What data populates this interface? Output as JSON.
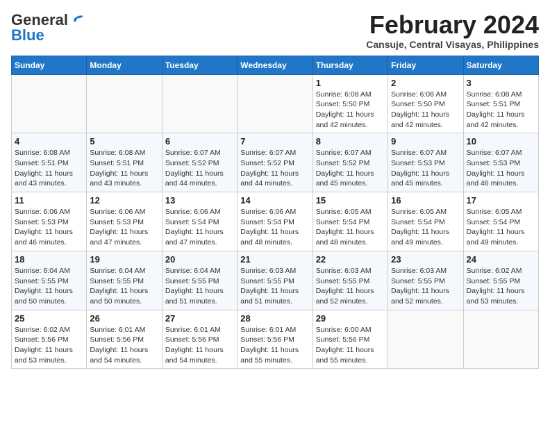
{
  "header": {
    "logo_line1": "General",
    "logo_line2": "Blue",
    "month_title": "February 2024",
    "location": "Cansuje, Central Visayas, Philippines"
  },
  "weekdays": [
    "Sunday",
    "Monday",
    "Tuesday",
    "Wednesday",
    "Thursday",
    "Friday",
    "Saturday"
  ],
  "weeks": [
    [
      {
        "date": "",
        "info": ""
      },
      {
        "date": "",
        "info": ""
      },
      {
        "date": "",
        "info": ""
      },
      {
        "date": "",
        "info": ""
      },
      {
        "date": "1",
        "info": "Sunrise: 6:08 AM\nSunset: 5:50 PM\nDaylight: 11 hours and 42 minutes."
      },
      {
        "date": "2",
        "info": "Sunrise: 6:08 AM\nSunset: 5:50 PM\nDaylight: 11 hours and 42 minutes."
      },
      {
        "date": "3",
        "info": "Sunrise: 6:08 AM\nSunset: 5:51 PM\nDaylight: 11 hours and 42 minutes."
      }
    ],
    [
      {
        "date": "4",
        "info": "Sunrise: 6:08 AM\nSunset: 5:51 PM\nDaylight: 11 hours and 43 minutes."
      },
      {
        "date": "5",
        "info": "Sunrise: 6:08 AM\nSunset: 5:51 PM\nDaylight: 11 hours and 43 minutes."
      },
      {
        "date": "6",
        "info": "Sunrise: 6:07 AM\nSunset: 5:52 PM\nDaylight: 11 hours and 44 minutes."
      },
      {
        "date": "7",
        "info": "Sunrise: 6:07 AM\nSunset: 5:52 PM\nDaylight: 11 hours and 44 minutes."
      },
      {
        "date": "8",
        "info": "Sunrise: 6:07 AM\nSunset: 5:52 PM\nDaylight: 11 hours and 45 minutes."
      },
      {
        "date": "9",
        "info": "Sunrise: 6:07 AM\nSunset: 5:53 PM\nDaylight: 11 hours and 45 minutes."
      },
      {
        "date": "10",
        "info": "Sunrise: 6:07 AM\nSunset: 5:53 PM\nDaylight: 11 hours and 46 minutes."
      }
    ],
    [
      {
        "date": "11",
        "info": "Sunrise: 6:06 AM\nSunset: 5:53 PM\nDaylight: 11 hours and 46 minutes."
      },
      {
        "date": "12",
        "info": "Sunrise: 6:06 AM\nSunset: 5:53 PM\nDaylight: 11 hours and 47 minutes."
      },
      {
        "date": "13",
        "info": "Sunrise: 6:06 AM\nSunset: 5:54 PM\nDaylight: 11 hours and 47 minutes."
      },
      {
        "date": "14",
        "info": "Sunrise: 6:06 AM\nSunset: 5:54 PM\nDaylight: 11 hours and 48 minutes."
      },
      {
        "date": "15",
        "info": "Sunrise: 6:05 AM\nSunset: 5:54 PM\nDaylight: 11 hours and 48 minutes."
      },
      {
        "date": "16",
        "info": "Sunrise: 6:05 AM\nSunset: 5:54 PM\nDaylight: 11 hours and 49 minutes."
      },
      {
        "date": "17",
        "info": "Sunrise: 6:05 AM\nSunset: 5:54 PM\nDaylight: 11 hours and 49 minutes."
      }
    ],
    [
      {
        "date": "18",
        "info": "Sunrise: 6:04 AM\nSunset: 5:55 PM\nDaylight: 11 hours and 50 minutes."
      },
      {
        "date": "19",
        "info": "Sunrise: 6:04 AM\nSunset: 5:55 PM\nDaylight: 11 hours and 50 minutes."
      },
      {
        "date": "20",
        "info": "Sunrise: 6:04 AM\nSunset: 5:55 PM\nDaylight: 11 hours and 51 minutes."
      },
      {
        "date": "21",
        "info": "Sunrise: 6:03 AM\nSunset: 5:55 PM\nDaylight: 11 hours and 51 minutes."
      },
      {
        "date": "22",
        "info": "Sunrise: 6:03 AM\nSunset: 5:55 PM\nDaylight: 11 hours and 52 minutes."
      },
      {
        "date": "23",
        "info": "Sunrise: 6:03 AM\nSunset: 5:55 PM\nDaylight: 11 hours and 52 minutes."
      },
      {
        "date": "24",
        "info": "Sunrise: 6:02 AM\nSunset: 5:55 PM\nDaylight: 11 hours and 53 minutes."
      }
    ],
    [
      {
        "date": "25",
        "info": "Sunrise: 6:02 AM\nSunset: 5:56 PM\nDaylight: 11 hours and 53 minutes."
      },
      {
        "date": "26",
        "info": "Sunrise: 6:01 AM\nSunset: 5:56 PM\nDaylight: 11 hours and 54 minutes."
      },
      {
        "date": "27",
        "info": "Sunrise: 6:01 AM\nSunset: 5:56 PM\nDaylight: 11 hours and 54 minutes."
      },
      {
        "date": "28",
        "info": "Sunrise: 6:01 AM\nSunset: 5:56 PM\nDaylight: 11 hours and 55 minutes."
      },
      {
        "date": "29",
        "info": "Sunrise: 6:00 AM\nSunset: 5:56 PM\nDaylight: 11 hours and 55 minutes."
      },
      {
        "date": "",
        "info": ""
      },
      {
        "date": "",
        "info": ""
      }
    ]
  ]
}
